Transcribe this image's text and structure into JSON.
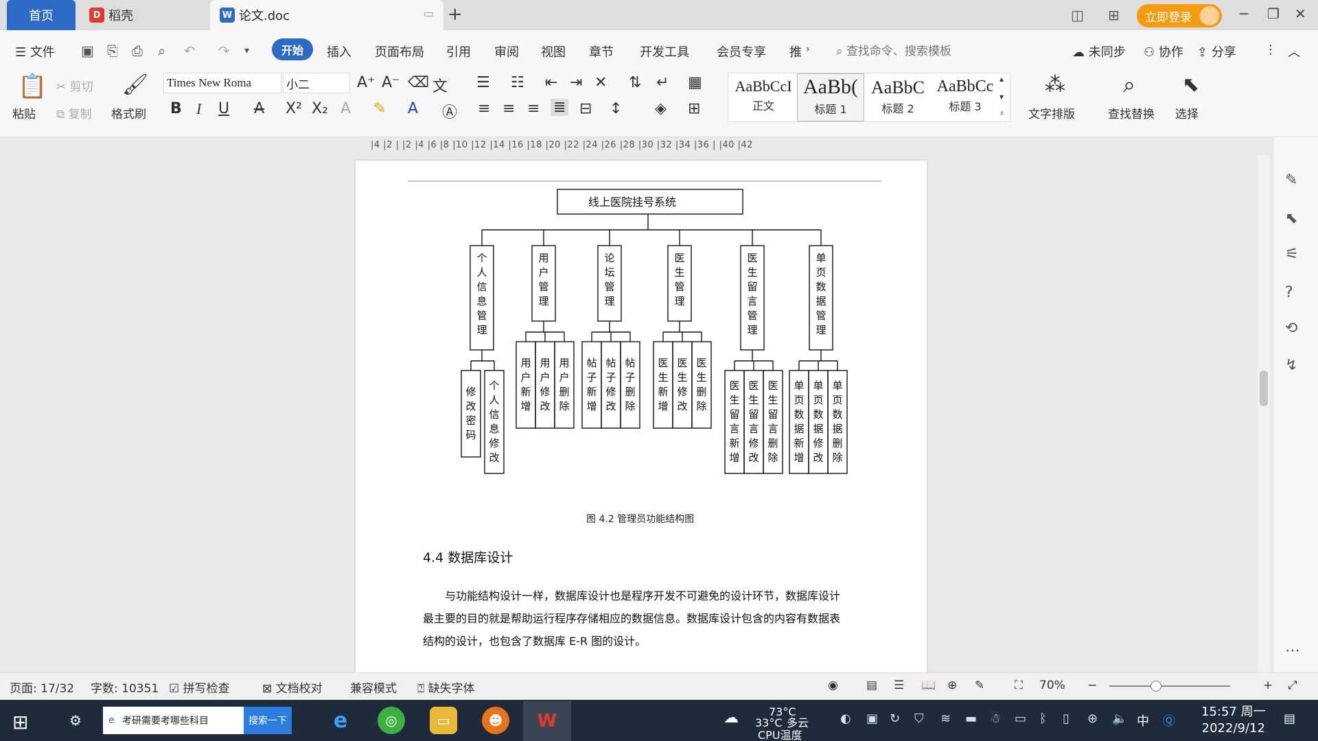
{
  "titlebar": {
    "tabs": [
      {
        "label": "首页"
      },
      {
        "label": "稻壳"
      },
      {
        "label": "论文.doc"
      }
    ],
    "login_label": "立即登录"
  },
  "menubar": {
    "file_label": "文件",
    "items": [
      "开始",
      "插入",
      "页面布局",
      "引用",
      "审阅",
      "视图",
      "章节",
      "开发工具",
      "会员专享",
      "推"
    ],
    "search_placeholder": "查找命令、搜索模板",
    "unsync_label": "未同步",
    "collab_label": "协作",
    "share_label": "分享"
  },
  "ribbon": {
    "paste_label": "粘贴",
    "cut_label": "剪切",
    "copy_label": "复制",
    "format_painter_label": "格式刷",
    "font_name": "Times New Roma",
    "font_size": "小二",
    "styles": [
      {
        "sample": "AaBbCcI",
        "name": "正文"
      },
      {
        "sample": "AaBb(",
        "name": "标题 1"
      },
      {
        "sample": "AaBbC",
        "name": "标题 2"
      },
      {
        "sample": "AaBbCc",
        "name": "标题 3"
      }
    ],
    "text_layout_label": "文字排版",
    "find_replace_label": "查找替换",
    "select_label": "选择"
  },
  "ruler": {
    "ticks": "|4 |2 |   |2 |4 |6 |8 |10 |12 |14 |16 |18 |20 |22 |24 |26 |28 |30 |32 |34 |36 |   |40 |42"
  },
  "document": {
    "chart": {
      "root": "线上医院挂号系统",
      "modules": [
        {
          "name": "个人信息管理",
          "children": [
            "修改密码",
            "个人信息修改"
          ]
        },
        {
          "name": "用户管理",
          "children": [
            "用户新增",
            "用户修改",
            "用户删除"
          ]
        },
        {
          "name": "论坛管理",
          "children": [
            "帖子新增",
            "帖子修改",
            "帖子删除"
          ]
        },
        {
          "name": "医生管理",
          "children": [
            "医生新增",
            "医生修改",
            "医生删除"
          ]
        },
        {
          "name": "医生留言管理",
          "children": [
            "医生留言新增",
            "医生留言修改",
            "医生留言删除"
          ]
        },
        {
          "name": "单页数据管理",
          "children": [
            "单页数据新增",
            "单页数据修改",
            "单页数据删除"
          ]
        }
      ]
    },
    "figure_caption": "图 4.2 管理员功能结构图",
    "section_heading": "4.4 数据库设计",
    "paragraph_lines": [
      "与功能结构设计一样，数据库设计也是程序开发不可避免的设计环节，数据库设计",
      "最主要的目的就是帮助运行程序存储相应的数据信息。数据库设计包含的内容有数据表",
      "结构的设计，也包含了数据库 E-R 图的设计。"
    ]
  },
  "statusbar": {
    "page": "页面: 17/32",
    "words": "字数: 10351",
    "spellcheck": "拼写检查",
    "proofread": "文档校对",
    "compat": "兼容模式",
    "missing_font": "缺失字体",
    "zoom": "70%"
  },
  "taskbar": {
    "search_text": "考研需要考哪些科目",
    "search_button": "搜索一下",
    "weather_temp": "33°C",
    "weather_cond": "多云",
    "cpu_temp": "73°C",
    "cpu_label": "CPU温度",
    "ime": "中",
    "time": "15:57 周一",
    "date": "2022/9/12"
  },
  "colors": {
    "accent": "#2d6ac6",
    "login": "#f39c12",
    "taskbar": "#1f2a3a"
  }
}
